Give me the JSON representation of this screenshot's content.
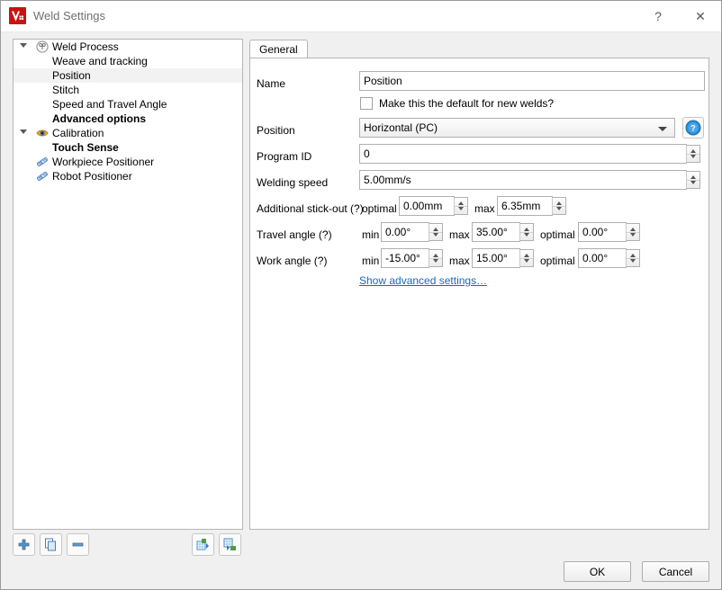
{
  "window": {
    "title": "Weld Settings",
    "app_icon": "weld-app-icon",
    "help_glyph": "?",
    "close_glyph": "✕"
  },
  "tree": {
    "items": [
      {
        "label": "Weld Process",
        "indent": 0,
        "expander": "down",
        "icon": "weld-torch-icon",
        "bold": false,
        "selected": false
      },
      {
        "label": "Weave and tracking",
        "indent": 1,
        "expander": "",
        "icon": "",
        "bold": false,
        "selected": false
      },
      {
        "label": "Position",
        "indent": 1,
        "expander": "",
        "icon": "",
        "bold": false,
        "selected": true
      },
      {
        "label": "Stitch",
        "indent": 1,
        "expander": "",
        "icon": "",
        "bold": false,
        "selected": false
      },
      {
        "label": "Speed and Travel Angle",
        "indent": 1,
        "expander": "",
        "icon": "",
        "bold": false,
        "selected": false
      },
      {
        "label": "Advanced options",
        "indent": 1,
        "expander": "",
        "icon": "",
        "bold": true,
        "selected": false
      },
      {
        "label": "Calibration",
        "indent": 0,
        "expander": "down",
        "icon": "eye-icon",
        "bold": false,
        "selected": false
      },
      {
        "label": "Touch Sense",
        "indent": 1,
        "expander": "",
        "icon": "",
        "bold": true,
        "selected": false
      },
      {
        "label": "Workpiece Positioner",
        "indent": 0,
        "expander": "",
        "icon": "positioner-icon",
        "bold": false,
        "selected": false
      },
      {
        "label": "Robot Positioner",
        "indent": 0,
        "expander": "",
        "icon": "positioner-icon",
        "bold": false,
        "selected": false
      }
    ]
  },
  "tree_toolbar": {
    "add": "add-icon",
    "duplicate": "duplicate-icon",
    "remove": "remove-icon",
    "import": "import-icon",
    "export": "export-icon"
  },
  "tabs": {
    "general": "General"
  },
  "form": {
    "name_label": "Name",
    "name_value": "Position",
    "default_checkbox_label": "Make this the default for new welds?",
    "default_checkbox_checked": false,
    "position_label": "Position",
    "position_value": "Horizontal (PC)",
    "help_icon": "help-circle-icon",
    "program_id_label": "Program ID",
    "program_id_value": "0",
    "welding_speed_label": "Welding speed",
    "welding_speed_value": "5.00mm/s",
    "stickout_label": "Additional stick-out (?)",
    "stickout_optimal_label": "optimal",
    "stickout_optimal_value": "0.00mm",
    "stickout_max_label": "max",
    "stickout_max_value": "6.35mm",
    "travel_angle_label": "Travel angle (?)",
    "travel_min_label": "min",
    "travel_min_value": "0.00°",
    "travel_max_label": "max",
    "travel_max_value": "35.00°",
    "travel_optimal_label": "optimal",
    "travel_optimal_value": "0.00°",
    "work_angle_label": "Work angle (?)",
    "work_min_label": "min",
    "work_min_value": "-15.00°",
    "work_max_label": "max",
    "work_max_value": "15.00°",
    "work_optimal_label": "optimal",
    "work_optimal_value": "0.00°",
    "advanced_link": "Show advanced settings…"
  },
  "buttons": {
    "ok": "OK",
    "cancel": "Cancel"
  },
  "colors": {
    "accent_link": "#1569c7",
    "app_icon_bg": "#cc1111",
    "selection": "#f2f2f2"
  }
}
